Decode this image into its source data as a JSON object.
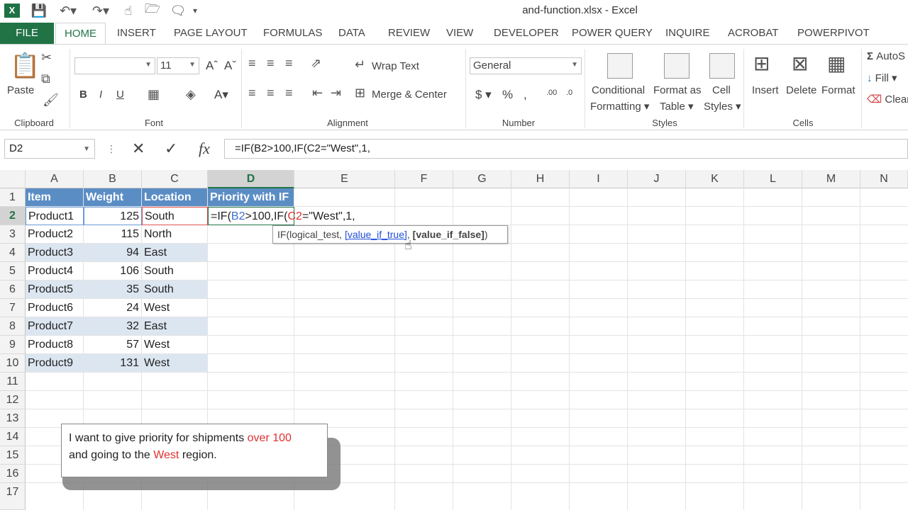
{
  "window": {
    "title": "and-function.xlsx - Excel"
  },
  "tabs": [
    "FILE",
    "HOME",
    "INSERT",
    "PAGE LAYOUT",
    "FORMULAS",
    "DATA",
    "REVIEW",
    "VIEW",
    "DEVELOPER",
    "POWER QUERY",
    "INQUIRE",
    "ACROBAT",
    "POWERPIVOT"
  ],
  "ribbon": {
    "clipboard": {
      "paste": "Paste",
      "label": "Clipboard"
    },
    "font": {
      "size": "11",
      "bold": "B",
      "italic": "I",
      "underline": "U",
      "label": "Font"
    },
    "alignment": {
      "wrap": "Wrap Text",
      "merge": "Merge & Center",
      "label": "Alignment"
    },
    "number": {
      "format": "General",
      "label": "Number"
    },
    "styles": {
      "conditional1": "Conditional",
      "conditional2": "Formatting",
      "table1": "Format as",
      "table2": "Table",
      "cell1": "Cell",
      "cell2": "Styles",
      "label": "Styles"
    },
    "cells": {
      "insert": "Insert",
      "delete": "Delete",
      "format": "Format",
      "label": "Cells"
    },
    "editing": {
      "autosum": "AutoS",
      "fill": "Fill",
      "clear": "Clear"
    }
  },
  "formula_bar": {
    "name_box": "D2",
    "fx": "fx",
    "formula": "=IF(B2>100,IF(C2=\"West\",1,"
  },
  "columns": [
    "A",
    "B",
    "C",
    "D",
    "E",
    "F",
    "G",
    "H",
    "I",
    "J",
    "K",
    "L",
    "M",
    "N"
  ],
  "rows": [
    "1",
    "2",
    "3",
    "4",
    "5",
    "6",
    "7",
    "8",
    "9",
    "10",
    "11",
    "12",
    "13",
    "14",
    "15",
    "16",
    "17"
  ],
  "table": {
    "headers": [
      "Item",
      "Weight",
      "Location",
      "Priority with IF"
    ],
    "data": [
      [
        "Product1",
        "125",
        "South"
      ],
      [
        "Product2",
        "115",
        "North"
      ],
      [
        "Product3",
        "94",
        "East"
      ],
      [
        "Product4",
        "106",
        "South"
      ],
      [
        "Product5",
        "35",
        "South"
      ],
      [
        "Product6",
        "24",
        "West"
      ],
      [
        "Product7",
        "32",
        "East"
      ],
      [
        "Product8",
        "57",
        "West"
      ],
      [
        "Product9",
        "131",
        "West"
      ]
    ]
  },
  "editing_cell": {
    "p1": "=IF(",
    "p2": "B2",
    "p3": ">100,IF(",
    "p4": "C2",
    "p5": "=\"West\",1,"
  },
  "tooltip": {
    "func": "IF(logical_test, ",
    "arg2": "[value_if_true]",
    "mid": ", ",
    "arg3": "[value_if_false]",
    "end": ")"
  },
  "callout": {
    "t1": "I want to give priority for shipments ",
    "t2": "over 100",
    "t3": "and going to the ",
    "t4": "West",
    "t5": " region."
  },
  "colors": {
    "excel_green": "#217346",
    "header_blue": "#5b8dc5",
    "band_blue": "#dce6f1",
    "highlight_red": "#e03030"
  }
}
